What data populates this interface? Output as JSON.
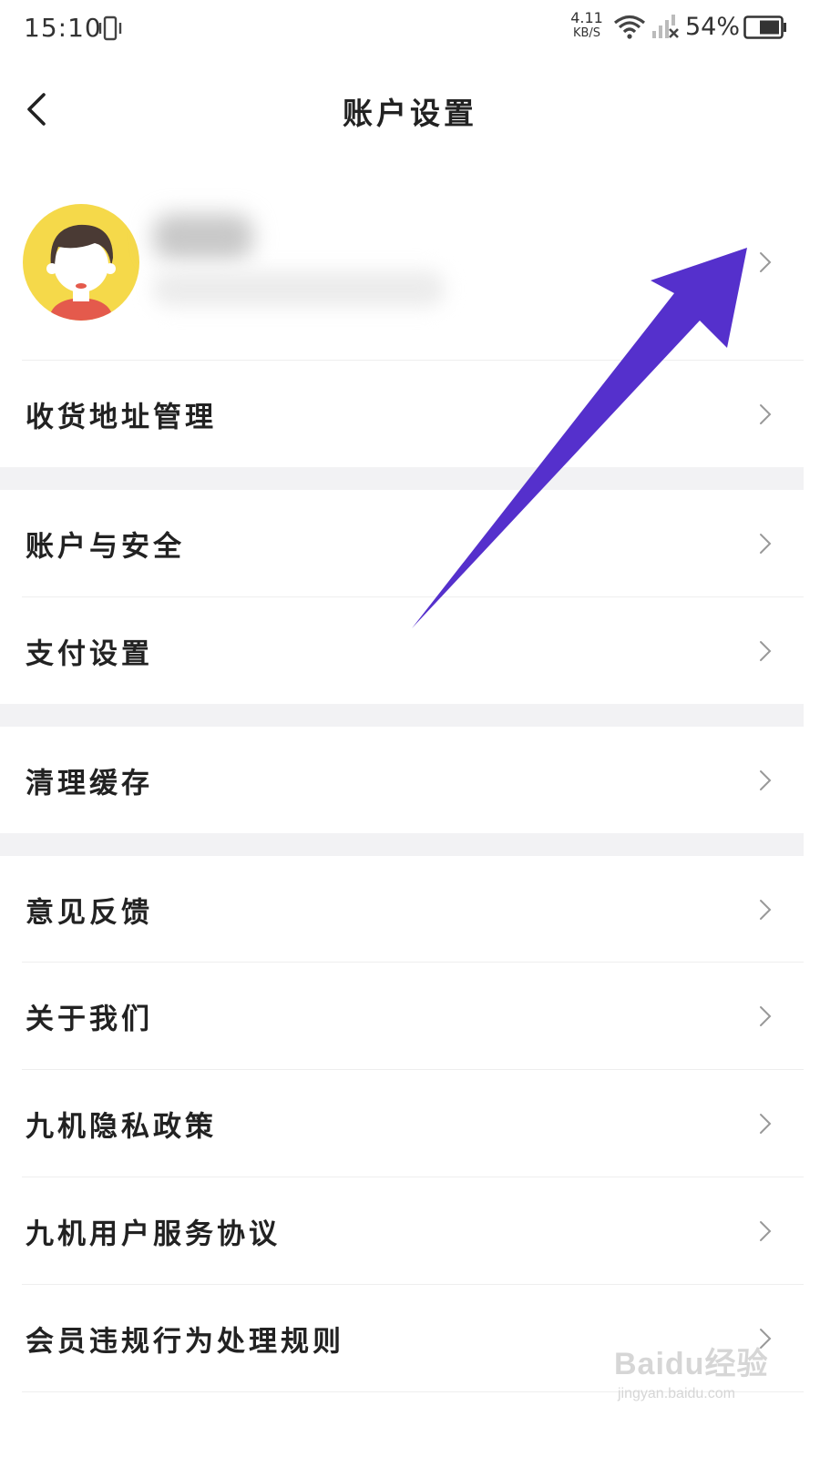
{
  "status_bar": {
    "time": "15:10",
    "net_speed_value": "4.11",
    "net_speed_unit": "KB/S",
    "battery_percent": "54%"
  },
  "header": {
    "title": "账户设置",
    "back_icon": "chevron-left-icon"
  },
  "profile": {
    "avatar_icon": "user-avatar-icon",
    "chevron_icon": "chevron-right-icon"
  },
  "menu": {
    "address": "收货地址管理",
    "account_security": "账户与安全",
    "payment": "支付设置",
    "clear_cache": "清理缓存",
    "feedback": "意见反馈",
    "about": "关于我们",
    "privacy": "九机隐私政策",
    "service_agreement": "九机用户服务协议",
    "member_rules": "会员违规行为处理规则"
  },
  "watermark": {
    "logo": "Baidu经验",
    "url": "jingyan.baidu.com"
  },
  "colors": {
    "annotation_arrow": "#5530cc",
    "section_gap": "#f2f2f4",
    "avatar_bg": "#f5d94a"
  }
}
